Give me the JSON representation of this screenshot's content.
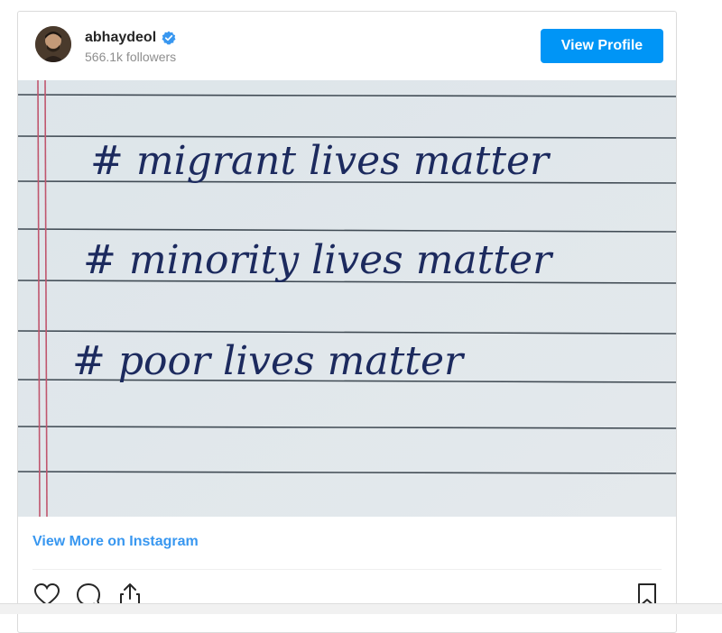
{
  "post": {
    "username": "abhaydeol",
    "followers": "566.1k followers",
    "view_profile_label": "View Profile",
    "view_more_label": "View More on Instagram",
    "image_lines": [
      "# migrant lives matter",
      "# minority lives matter",
      "# poor lives matter"
    ]
  },
  "icons": {
    "verified": "verified-badge-icon",
    "like": "heart-icon",
    "comment": "comment-icon",
    "share": "share-icon",
    "save": "bookmark-icon"
  },
  "colors": {
    "button_blue": "#0095f6",
    "link_blue": "#3897f0",
    "ink": "#1c2a5e",
    "paper": "#dfe6ea"
  }
}
